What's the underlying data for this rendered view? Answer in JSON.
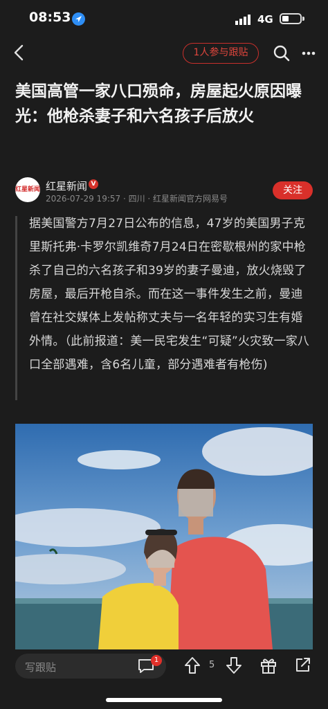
{
  "status_bar": {
    "time": "08:53",
    "network": "4G"
  },
  "nav": {
    "follow_pill": "1人参与跟贴"
  },
  "article": {
    "title": "美国高管一家八口殒命，房屋起火原因曝光：他枪杀妻子和六名孩子后放火",
    "author": {
      "avatar_text": "红星新闻",
      "name": "红星新闻",
      "verified_badge": "V",
      "meta": "2026-07-29 19:57 · 四川 · 红星新闻官方网易号",
      "follow_label": "关注"
    },
    "quote": "据美国警方7月27日公布的信息，47岁的美国男子克里斯托弗·卡罗尔凯维奇7月24日在密歇根州的家中枪杀了自己的六名孩子和39岁的妻子曼迪，放火烧毁了房屋，最后开枪自杀。而在这一事件发生之前，曼迪曾在社交媒体上发帖称丈夫与一名年轻的实习生有婚外情。（此前报道：美一民宅发生“可疑”火灾致一家八口全部遇难，含6名儿童，部分遇难者有枪伤)"
  },
  "bottom_bar": {
    "comment_placeholder": "写跟贴",
    "comment_badge": "1",
    "vote_count": "5"
  },
  "colors": {
    "background": "#1c1c1c",
    "accent_red": "#d9302a",
    "text": "#e6e6e6"
  },
  "icons": [
    "location-arrow-icon",
    "signal-icon",
    "battery-icon",
    "back-icon",
    "search-icon",
    "more-icon",
    "comment-icon",
    "upvote-icon",
    "downvote-icon",
    "gift-icon",
    "share-icon"
  ]
}
